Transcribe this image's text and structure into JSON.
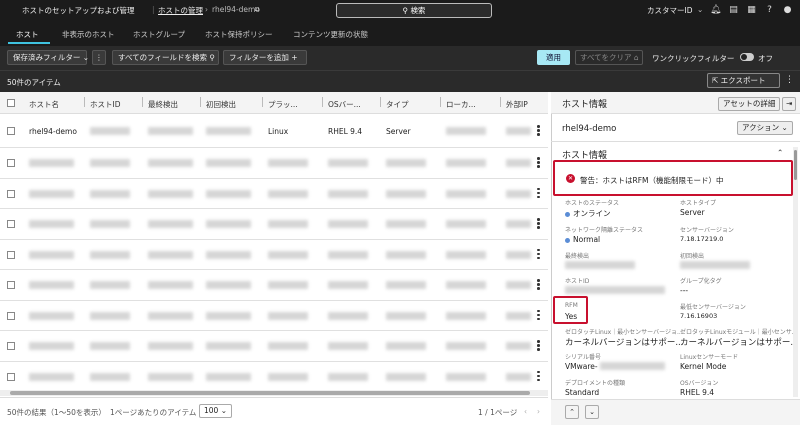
{
  "topbar": {
    "breadcrumb_1": "ホストのセットアップおよび管理",
    "breadcrumb_2": "ホストの管理",
    "breadcrumb_3": "rhel94-demo",
    "search_label": "検索",
    "user_label": "カスタマーID"
  },
  "tabs": [
    {
      "label": "ホスト"
    },
    {
      "label": "非表示のホスト"
    },
    {
      "label": "ホストグループ"
    },
    {
      "label": "ホスト保持ポリシー"
    },
    {
      "label": "コンテンツ更新の状態"
    }
  ],
  "filters": {
    "saved_filter": "保存済みフィルター",
    "search_all": "すべてのフィールドを検索",
    "add_filter": "フィルターを追加",
    "apply": "適用",
    "clear_all": "すべてをクリア",
    "one_click": "ワンクリックフィルター",
    "toggle_state": "オフ"
  },
  "list": {
    "count": "50件のアイテム",
    "export": "エクスポート",
    "columns": [
      "ホスト名",
      "ホストID",
      "最終検出",
      "初回検出",
      "プラッ...",
      "OSバー...",
      "タイプ",
      "ローカ...",
      "外部IP"
    ],
    "first_row": {
      "hostname": "rhel94-demo",
      "platform": "Linux",
      "os": "RHEL 9.4",
      "type": "Server"
    }
  },
  "footer": {
    "results": "50件の結果（1〜50を表示）",
    "per_page_label": "1ページあたりのアイテム",
    "per_page_value": "100",
    "page": "1 / 1ページ"
  },
  "panel": {
    "title": "ホスト情報",
    "asset_details": "アセットの詳細",
    "host_name": "rhel94-demo",
    "action": "アクション",
    "section_title": "ホスト情報",
    "warning": "警告：ホストはRFM（機能制限モード）中",
    "fields": {
      "status_label": "ホストのステータス",
      "status_value": "オンライン",
      "type_label": "ホストタイプ",
      "type_value": "Server",
      "net_label": "ネットワーク隔離ステータス",
      "net_value": "Normal",
      "sensor_label": "センサーバージョン",
      "sensor_value": "7.18.17219.0",
      "last_label": "最終検出",
      "first_label": "初回検出",
      "host_id_label": "ホストID",
      "group_label": "グループ化タグ",
      "group_value": "---",
      "rfm_label": "RFM",
      "rfm_value": "Yes",
      "min_sensor_label": "最低センサーバージョン",
      "min_sensor_value": "7.16.16903",
      "zero_label": "ゼロタッチLinux｜最小センサーバージョ...",
      "zero_value": "カーネルバージョンはサポー...",
      "zero_mod_label": "ゼロタッチLinuxモジュール｜最小センサ...",
      "zero_mod_value": "カーネルバージョンはサポー...",
      "serial_label": "シリアル番号",
      "serial_value": "VMware-",
      "linux_mode_label": "Linuxセンサーモード",
      "linux_mode_value": "Kernel Mode",
      "deploy_label": "デプロイメントの種類",
      "deploy_value": "Standard",
      "os_label": "OSバージョン",
      "os_value": "RHEL 9.4"
    }
  },
  "colors": {
    "accent": "#3fc3e0",
    "warning_border": "#c8102e",
    "apply_bg": "#a7e8f4"
  }
}
